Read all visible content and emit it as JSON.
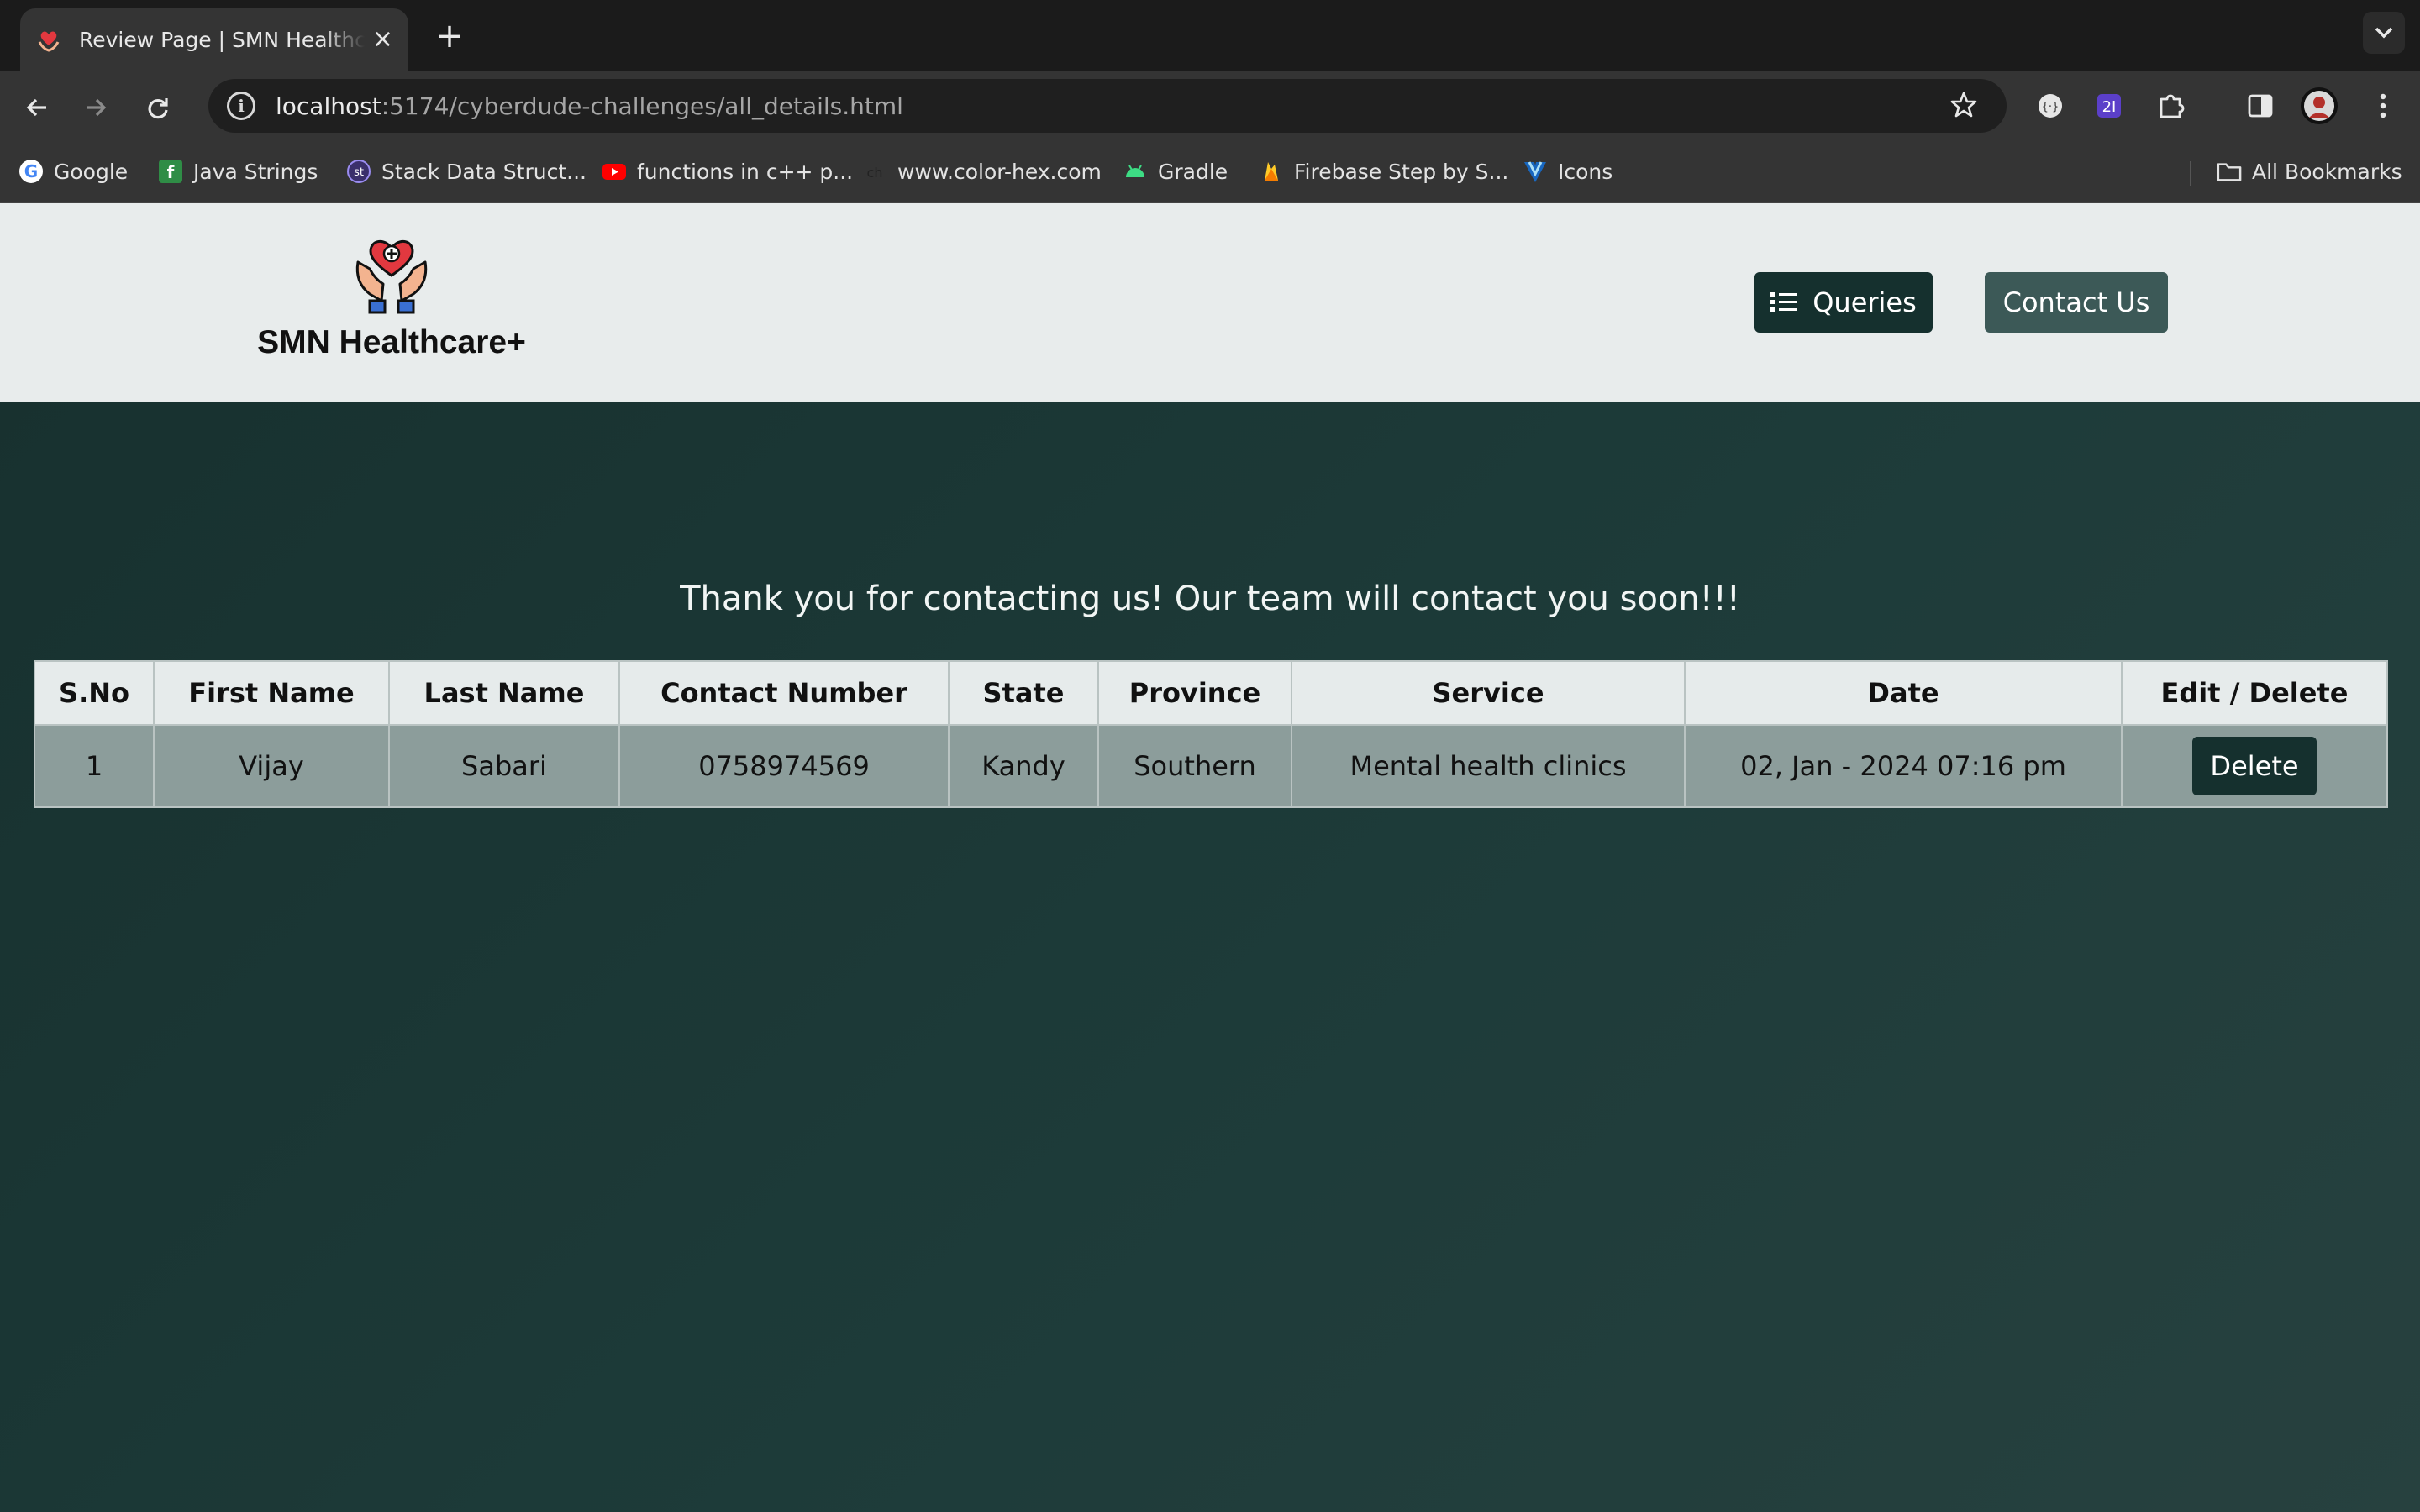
{
  "browser": {
    "tab_title": "Review Page | SMN Healthcare+",
    "new_tab_label": "+",
    "url_host": "localhost",
    "url_rest": ":5174/cyberdude-challenges/all_details.html",
    "bookmarks": [
      {
        "label": "Google",
        "icon": "google-icon"
      },
      {
        "label": "Java Strings",
        "icon": "java-strings-icon"
      },
      {
        "label": "Stack Data Struct...",
        "icon": "stack-icon"
      },
      {
        "label": "functions in c++ p...",
        "icon": "youtube-icon"
      },
      {
        "label": "www.color-hex.com",
        "icon": "color-hex-icon"
      },
      {
        "label": "Gradle",
        "icon": "android-icon"
      },
      {
        "label": "Firebase Step by S...",
        "icon": "firebase-icon"
      },
      {
        "label": "Icons",
        "icon": "vuetify-icon"
      }
    ],
    "all_bookmarks_label": "All Bookmarks"
  },
  "header": {
    "brand": "SMN Healthcare+",
    "queries_label": "Queries",
    "contact_label": "Contact Us"
  },
  "main": {
    "message": "Thank you for contacting us! Our team will contact you soon!!!",
    "table": {
      "columns": [
        "S.No",
        "First Name",
        "Last Name",
        "Contact Number",
        "State",
        "Province",
        "Service",
        "Date",
        "Edit / Delete"
      ],
      "rows": [
        {
          "sno": "1",
          "first_name": "Vijay",
          "last_name": "Sabari",
          "contact": "0758974569",
          "state": "Kandy",
          "province": "Southern",
          "service": "Mental health clinics",
          "date": "02, Jan - 2024 07:16 pm",
          "action_label": "Delete"
        }
      ]
    }
  },
  "colors": {
    "header_bg": "#e8ecec",
    "page_bg": "#1d3b39",
    "primary_button": "#15302e",
    "secondary_button": "#3c5957",
    "table_row_bg": "#8c9d9b"
  }
}
